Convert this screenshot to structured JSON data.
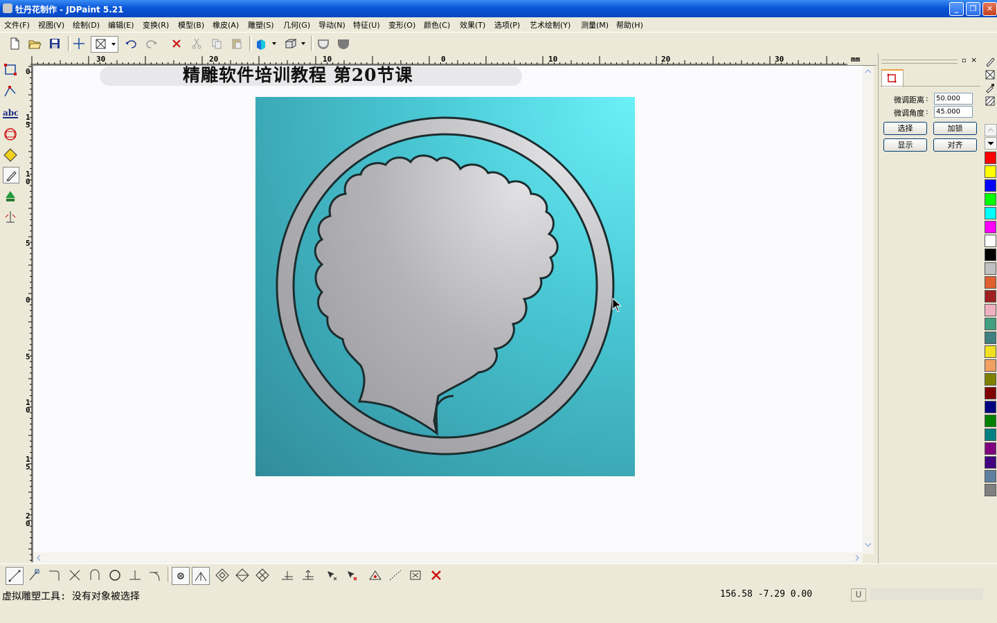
{
  "window": {
    "title": "牡丹花制作 - JDPaint 5.21",
    "buttons": [
      "minimize",
      "restore",
      "close"
    ]
  },
  "menu": [
    "文件(F)",
    "视图(V)",
    "绘制(D)",
    "编辑(E)",
    "变换(R)",
    "模型(B)",
    "橡皮(A)",
    "雕塑(S)",
    "几何(G)",
    "导动(N)",
    "特征(U)",
    "变形(O)",
    "颜色(C)",
    "效果(T)",
    "选项(P)",
    "艺术绘制(Y)",
    "测量(M)",
    "帮助(H)"
  ],
  "toolbar": [
    "new-icon",
    "open-icon",
    "save-icon",
    "crosshair-icon",
    "box-select-icon",
    "undo-icon",
    "redo-icon",
    "delete-icon",
    "cut-icon",
    "copy-icon",
    "paste-icon",
    "shade-icon",
    "view-cube-icon",
    "shield-left-icon",
    "shield-right-icon"
  ],
  "ruler": {
    "unit": "mm",
    "top_labels": [
      "30",
      "20",
      "10",
      "0",
      "10",
      "20",
      "30"
    ],
    "left_labels": [
      "0",
      "15",
      "10",
      "5",
      "0",
      "5",
      "10",
      "15",
      "20"
    ]
  },
  "canvas": {
    "banner_text": "精雕软件培训教程  第20节课"
  },
  "panel": {
    "fine_distance_label": "微调距离",
    "fine_distance_value": "50.000",
    "fine_angle_label": "微调角度",
    "fine_angle_value": "45.000",
    "select_button": "选择",
    "lock_button": "加锁",
    "show_button": "显示",
    "align_button": "对齐"
  },
  "palette": [
    "#ff0000",
    "#ffff00",
    "#0000ff",
    "#00ff00",
    "#00ffff",
    "#ff00ff",
    "#ffffff",
    "#000000",
    "#c0c0c0",
    "#e06030",
    "#a02020",
    "#f0b0c0",
    "#40a080",
    "#408080",
    "#f0e020",
    "#f0a060",
    "#808000",
    "#800000",
    "#000080",
    "#008000",
    "#008080",
    "#800080",
    "#400080",
    "#6080a0",
    "#808080"
  ],
  "status": {
    "message": "虚拟雕塑工具: 没有对象被选择",
    "coordinates": "156.58 -7.29 0.00",
    "mode": "U"
  }
}
